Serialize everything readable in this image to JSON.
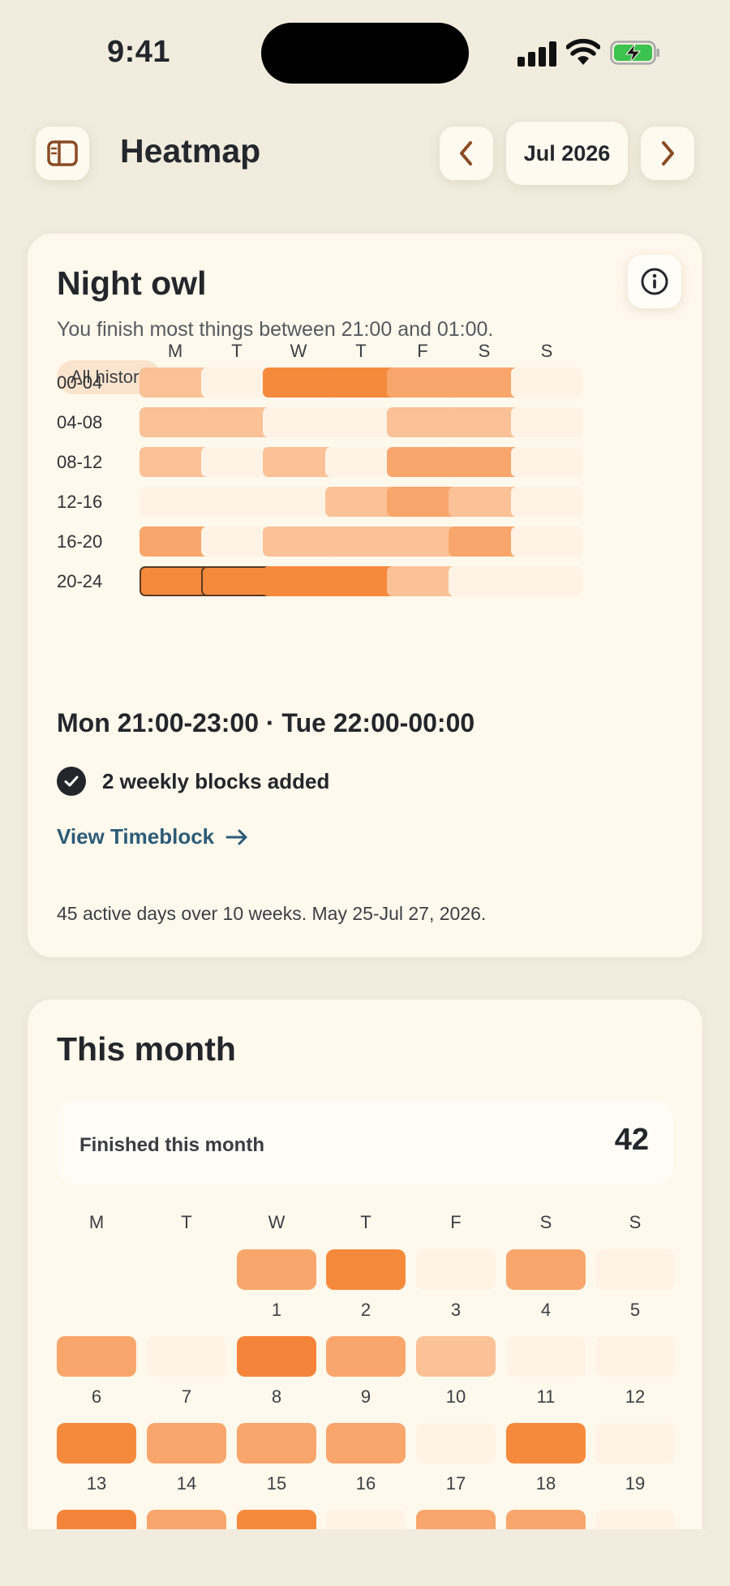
{
  "status_bar": {
    "time": "9:41"
  },
  "header": {
    "title": "Heatmap",
    "month": "Jul 2026",
    "sidebar_icon": "sidebar-icon",
    "prev_icon": "chevron-left-icon",
    "next_icon": "chevron-right-icon"
  },
  "night_owl": {
    "title": "Night owl",
    "subtitle": "You finish most things between 21:00 and 01:00.",
    "tag": "All history",
    "days": [
      "M",
      "T",
      "W",
      "T",
      "F",
      "S",
      "S"
    ],
    "rows": [
      "00-04",
      "04-08",
      "08-12",
      "12-16",
      "16-20",
      "20-24"
    ],
    "levels": [
      [
        2,
        0,
        4,
        4,
        3,
        3,
        0
      ],
      [
        2,
        2,
        0,
        0,
        2,
        2,
        0
      ],
      [
        2,
        0,
        2,
        0,
        3,
        3,
        0
      ],
      [
        0,
        0,
        0,
        2,
        3,
        2,
        0
      ],
      [
        3,
        0,
        2,
        2,
        2,
        3,
        0
      ],
      [
        4,
        4,
        4,
        4,
        2,
        0,
        0
      ]
    ],
    "selected": [
      [
        5,
        0
      ],
      [
        5,
        1
      ]
    ],
    "result": "Mon 21:00-23:00 · Tue 22:00-00:00",
    "confirmation": "2 weekly blocks added",
    "link": "View Timeblock",
    "footnote": "45 active days over 10 weeks. May 25-Jul 27, 2026."
  },
  "this_month": {
    "title": "This month",
    "stat_label": "Finished this month",
    "stat_value": "42",
    "days": [
      "M",
      "T",
      "W",
      "T",
      "F",
      "S",
      "S"
    ],
    "weeks": [
      {
        "levels": [
          -1,
          -1,
          3,
          4,
          0,
          3,
          0
        ],
        "numbers": [
          "",
          "",
          "1",
          "2",
          "3",
          "4",
          "5"
        ]
      },
      {
        "levels": [
          3,
          0,
          5,
          3,
          2,
          0,
          0
        ],
        "numbers": [
          "6",
          "7",
          "8",
          "9",
          "10",
          "11",
          "12"
        ]
      },
      {
        "levels": [
          4,
          3,
          3,
          3,
          0,
          4,
          0
        ],
        "numbers": [
          "13",
          "14",
          "15",
          "16",
          "17",
          "18",
          "19"
        ]
      },
      {
        "levels": [
          5,
          3,
          4,
          0,
          3,
          3,
          0
        ],
        "numbers": []
      }
    ]
  },
  "colors": {
    "level0": "#fff3e6",
    "level2": "#fbc197",
    "level3": "#f8a66c",
    "level4": "#f68a3c",
    "level5": "#f4843a"
  }
}
